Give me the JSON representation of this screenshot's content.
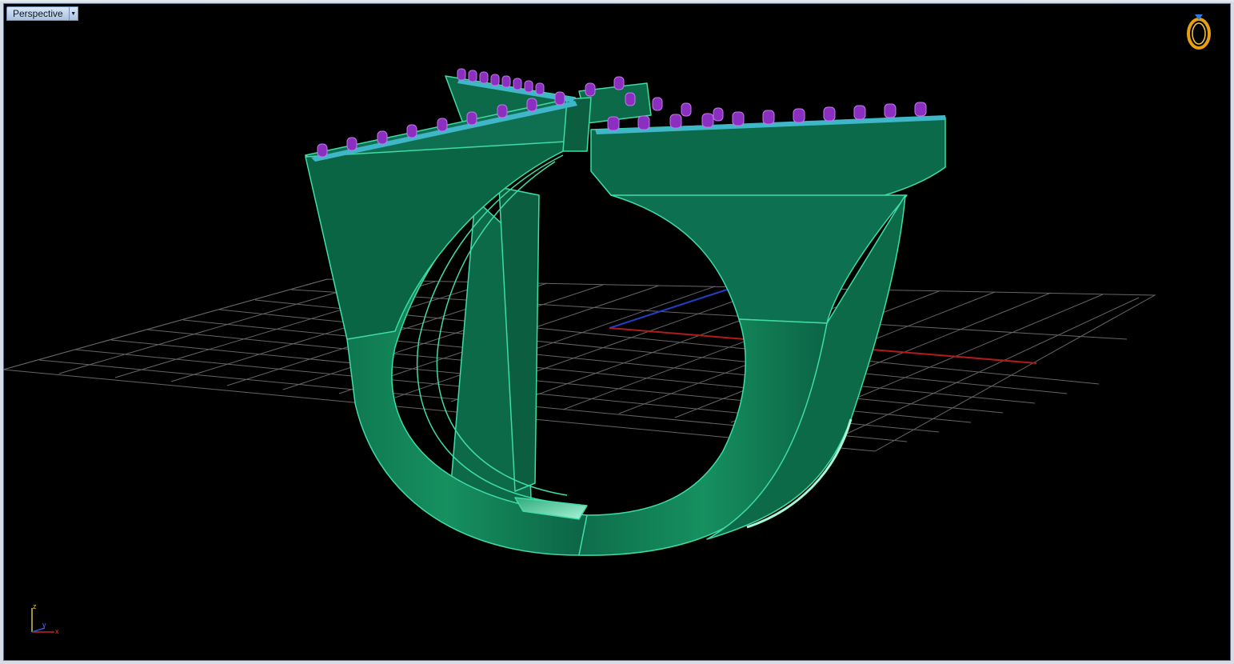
{
  "viewport": {
    "title": "Perspective",
    "menu_icon": "triangle-down-icon"
  },
  "axis_widget": {
    "z": "z",
    "y": "y",
    "x": "x"
  },
  "colors": {
    "background": "#000000",
    "model": "#0f7a55",
    "model_edge": "#3fdca8",
    "prongs": "#8a2fc0",
    "grid": "#7a7a7a",
    "x_axis": "#b01c1c",
    "y_axis": "#1c36b0"
  },
  "display_mode_icon": "ring-icon"
}
